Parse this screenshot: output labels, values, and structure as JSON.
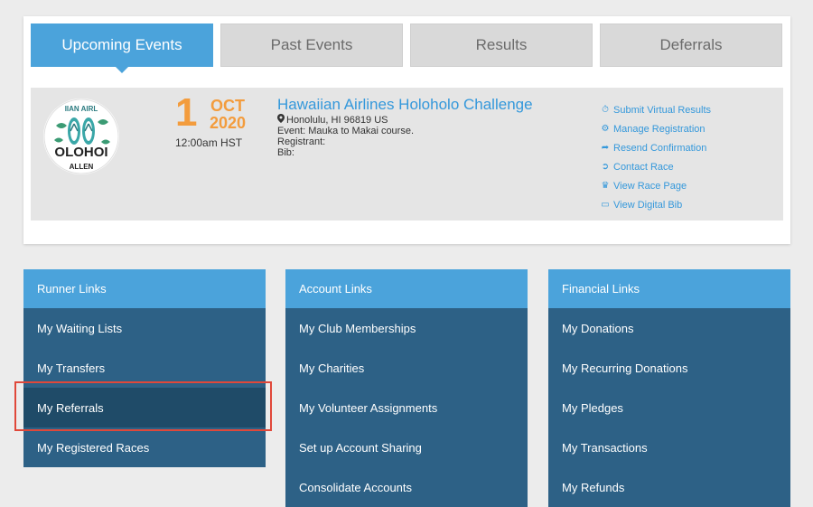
{
  "tabs": [
    {
      "label": "Upcoming Events",
      "active": true
    },
    {
      "label": "Past Events",
      "active": false
    },
    {
      "label": "Results",
      "active": false
    },
    {
      "label": "Deferrals",
      "active": false
    }
  ],
  "event": {
    "logo_text_top": "IIAN AIRL",
    "logo_text_mid": "OLOHOI",
    "logo_text_bot": "ALLEN",
    "day": "1",
    "month": "OCT",
    "year": "2020",
    "time": "12:00am HST",
    "title": "Hawaiian Airlines Holoholo Challenge",
    "location": "Honolulu, HI 96819 US",
    "event_line": "Event: Mauka to Makai course.",
    "registrant_label": "Registrant:",
    "bib_label": "Bib:",
    "actions": [
      {
        "label": "Submit Virtual Results",
        "icon": "stopwatch-icon"
      },
      {
        "label": "Manage Registration",
        "icon": "gear-icon"
      },
      {
        "label": "Resend Confirmation",
        "icon": "share-icon"
      },
      {
        "label": "Contact Race",
        "icon": "arrow-circle-icon"
      },
      {
        "label": "View Race Page",
        "icon": "trophy-icon"
      },
      {
        "label": "View Digital Bib",
        "icon": "card-icon"
      }
    ]
  },
  "panels": [
    {
      "title": "Runner Links",
      "items": [
        "My Waiting Lists",
        "My Transfers",
        "My Referrals",
        "My Registered Races"
      ]
    },
    {
      "title": "Account Links",
      "items": [
        "My Club Memberships",
        "My Charities",
        "My Volunteer Assignments",
        "Set up Account Sharing",
        "Consolidate Accounts"
      ]
    },
    {
      "title": "Financial Links",
      "items": [
        "My Donations",
        "My Recurring Donations",
        "My Pledges",
        "My Transactions",
        "My Refunds"
      ]
    }
  ],
  "colors": {
    "accent": "#4ba3db",
    "panel": "#2d6186",
    "date": "#f39c3d",
    "link": "#3498db",
    "highlight": "#e0483a"
  }
}
